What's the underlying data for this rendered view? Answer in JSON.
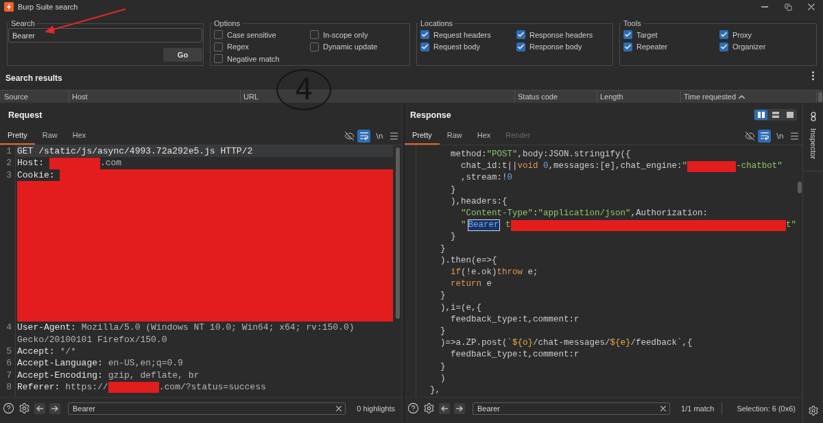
{
  "window": {
    "title": "Burp Suite search"
  },
  "search": {
    "legend": "Search",
    "value": "Bearer",
    "go_button": "Go"
  },
  "options": {
    "legend": "Options",
    "items": [
      {
        "label": "Case sensitive",
        "checked": false
      },
      {
        "label": "In-scope only",
        "checked": false
      },
      {
        "label": "Regex",
        "checked": false
      },
      {
        "label": "Dynamic update",
        "checked": false
      },
      {
        "label": "Negative match",
        "checked": false
      }
    ]
  },
  "locations": {
    "legend": "Locations",
    "items": [
      {
        "label": "Request headers",
        "checked": true
      },
      {
        "label": "Response headers",
        "checked": true
      },
      {
        "label": "Request body",
        "checked": true
      },
      {
        "label": "Response body",
        "checked": true
      }
    ]
  },
  "tools": {
    "legend": "Tools",
    "items": [
      {
        "label": "Target",
        "checked": true
      },
      {
        "label": "Proxy",
        "checked": true
      },
      {
        "label": "Repeater",
        "checked": true
      },
      {
        "label": "Organizer",
        "checked": true
      }
    ]
  },
  "results": {
    "title": "Search results",
    "columns": [
      {
        "label": "Source",
        "sorted": false
      },
      {
        "label": "Host",
        "sorted": false
      },
      {
        "label": "URL",
        "sorted": false
      },
      {
        "label": "Status code",
        "sorted": false
      },
      {
        "label": "Length",
        "sorted": false
      },
      {
        "label": "Time requested",
        "sorted": true
      }
    ]
  },
  "request": {
    "title": "Request",
    "tabs": [
      {
        "label": "Pretty",
        "selected": true
      },
      {
        "label": "Raw",
        "selected": false
      },
      {
        "label": "Hex",
        "selected": false
      }
    ],
    "word_wrap": true,
    "newline_toggle": "\\n",
    "lines": [
      {
        "number": "1",
        "current": true,
        "segments": [
          {
            "kind": "name",
            "text": "GET /static/js/async/4993.72a292e5.js HTTP/2"
          }
        ]
      },
      {
        "number": "2",
        "current": false,
        "segments": [
          {
            "kind": "name",
            "text": "Host: "
          },
          {
            "kind": "redacted"
          },
          {
            "kind": "value",
            "text": ".com"
          }
        ]
      },
      {
        "number": "3",
        "current": false,
        "segments": [
          {
            "kind": "name",
            "text": "Cookie: "
          },
          {
            "kind": "redacted_fill"
          },
          {
            "kind": "redacted_block"
          }
        ]
      },
      {
        "number": "4",
        "current": false,
        "segments": [
          {
            "kind": "name",
            "text": "User-Agent: "
          },
          {
            "kind": "value",
            "text": "Mozilla/5.0 (Windows NT 10.0; Win64; x64; rv:150.0) Gecko/20100101 Firefox/150.0"
          }
        ]
      },
      {
        "number": "5",
        "current": false,
        "segments": [
          {
            "kind": "name",
            "text": "Accept: "
          },
          {
            "kind": "value",
            "text": "*/*"
          }
        ]
      },
      {
        "number": "6",
        "current": false,
        "segments": [
          {
            "kind": "name",
            "text": "Accept-Language: "
          },
          {
            "kind": "value",
            "text": "en-US,en;q=0.9"
          }
        ]
      },
      {
        "number": "7",
        "current": false,
        "segments": [
          {
            "kind": "name",
            "text": "Accept-Encoding: "
          },
          {
            "kind": "value",
            "text": "gzip, deflate, br"
          }
        ]
      },
      {
        "number": "8",
        "current": false,
        "segments": [
          {
            "kind": "name",
            "text": "Referer: "
          },
          {
            "kind": "value",
            "text": "https://"
          },
          {
            "kind": "redacted"
          },
          {
            "kind": "value",
            "text": ".com/?status=success"
          }
        ]
      }
    ],
    "find": {
      "value": "Bearer",
      "status": "0 highlights"
    }
  },
  "response": {
    "title": "Response",
    "layouts": [
      {
        "kind": "columns",
        "selected": true
      },
      {
        "kind": "rows",
        "selected": false
      },
      {
        "kind": "single",
        "selected": false
      }
    ],
    "tabs": [
      {
        "label": "Pretty",
        "selected": true,
        "disabled": false
      },
      {
        "label": "Raw",
        "selected": false,
        "disabled": false
      },
      {
        "label": "Hex",
        "selected": false,
        "disabled": false
      },
      {
        "label": "Render",
        "selected": false,
        "disabled": true
      }
    ],
    "word_wrap": true,
    "newline_toggle": "\\n",
    "lines": [
      {
        "segments": [
          {
            "kind": "plain",
            "text": "      method:"
          },
          {
            "kind": "string",
            "text": "\"POST\""
          },
          {
            "kind": "plain",
            "text": ",body:JSON.stringify({"
          }
        ]
      },
      {
        "segments": [
          {
            "kind": "plain",
            "text": "        chat_id:t||"
          },
          {
            "kind": "keyword",
            "text": "void"
          },
          {
            "kind": "number",
            "text": " 0"
          },
          {
            "kind": "plain",
            "text": ",messages:[e],chat_engine:"
          },
          {
            "kind": "string",
            "text": "\""
          },
          {
            "kind": "redacted"
          },
          {
            "kind": "string",
            "text": "-chatbot\""
          }
        ]
      },
      {
        "segments": [
          {
            "kind": "plain",
            "text": "        ,stream:!"
          },
          {
            "kind": "number",
            "text": "0"
          }
        ]
      },
      {
        "segments": [
          {
            "kind": "plain",
            "text": "      }"
          }
        ]
      },
      {
        "segments": [
          {
            "kind": "plain",
            "text": "      ),headers:{"
          }
        ]
      },
      {
        "segments": [
          {
            "kind": "string",
            "text": "        \"Content-Type\""
          },
          {
            "kind": "plain",
            "text": ":"
          },
          {
            "kind": "string",
            "text": "\"application/json\""
          },
          {
            "kind": "plain",
            "text": ",Authorization:"
          }
        ]
      },
      {
        "segments": [
          {
            "kind": "string",
            "text": "        \""
          },
          {
            "kind": "match",
            "text": "Bearer"
          },
          {
            "kind": "string",
            "text": " t"
          },
          {
            "kind": "redacted_fill"
          },
          {
            "kind": "string",
            "text": "t\""
          }
        ]
      },
      {
        "segments": [
          {
            "kind": "plain",
            "text": "      }"
          }
        ]
      },
      {
        "segments": [
          {
            "kind": "plain",
            "text": "    }"
          }
        ]
      },
      {
        "segments": [
          {
            "kind": "plain",
            "text": "    ).then(e=>{"
          }
        ]
      },
      {
        "segments": [
          {
            "kind": "keyword",
            "text": "      if"
          },
          {
            "kind": "plain",
            "text": "(!e.ok)"
          },
          {
            "kind": "keyword",
            "text": "throw"
          },
          {
            "kind": "plain",
            "text": " e;"
          }
        ]
      },
      {
        "segments": [
          {
            "kind": "keyword",
            "text": "      return"
          },
          {
            "kind": "plain",
            "text": " e"
          }
        ]
      },
      {
        "segments": [
          {
            "kind": "plain",
            "text": "    }"
          }
        ]
      },
      {
        "segments": [
          {
            "kind": "plain",
            "text": "    ),i=(e,{"
          }
        ]
      },
      {
        "segments": [
          {
            "kind": "plain",
            "text": "      feedback_type:t,comment:r"
          }
        ]
      },
      {
        "segments": [
          {
            "kind": "plain",
            "text": "    }"
          }
        ]
      },
      {
        "segments": [
          {
            "kind": "plain",
            "text": "    )=>a.ZP.post(`"
          },
          {
            "kind": "template",
            "text": "${o}"
          },
          {
            "kind": "plain",
            "text": "/chat-messages/"
          },
          {
            "kind": "template",
            "text": "${e}"
          },
          {
            "kind": "plain",
            "text": "/feedback`,{"
          }
        ]
      },
      {
        "segments": [
          {
            "kind": "plain",
            "text": "      feedback_type:t,comment:r"
          }
        ]
      },
      {
        "segments": [
          {
            "kind": "plain",
            "text": "    }"
          }
        ]
      },
      {
        "segments": [
          {
            "kind": "plain",
            "text": "    )"
          }
        ]
      },
      {
        "segments": [
          {
            "kind": "plain",
            "text": "  },"
          }
        ]
      }
    ],
    "find": {
      "value": "Bearer",
      "status": "1/1 match",
      "selection": "Selection: 6 (0x6)"
    }
  },
  "inspector": {
    "label": "Inspector"
  },
  "annotation": {
    "step_number": "4"
  }
}
